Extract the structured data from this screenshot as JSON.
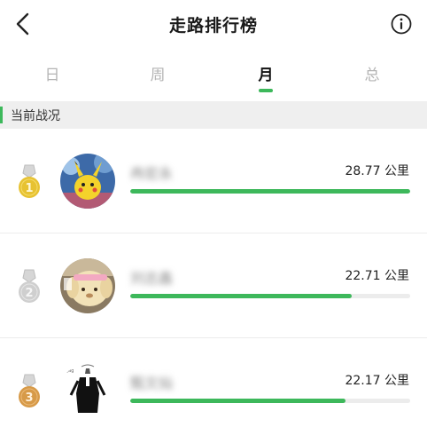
{
  "header": {
    "title": "走路排行榜",
    "back_icon": "chevron-left-icon",
    "info_icon": "info-circle-icon"
  },
  "tabs": [
    {
      "label": "日",
      "active": false
    },
    {
      "label": "周",
      "active": false
    },
    {
      "label": "月",
      "active": true
    },
    {
      "label": "总",
      "active": false
    }
  ],
  "section": {
    "title": "当前战况"
  },
  "colors": {
    "accent": "#3db85b",
    "gold": "#e7c232",
    "silver": "#cfcfcf",
    "bronze": "#d79a48"
  },
  "rankings": [
    {
      "rank": "1",
      "name": "冉宏永",
      "distance": "28.77 公里",
      "progress": 1.0,
      "medal": "gold-medal-icon",
      "avatar": "pikachu-avatar"
    },
    {
      "rank": "2",
      "name": "刘志鑫",
      "distance": "22.71 公里",
      "progress": 0.79,
      "medal": "silver-medal-icon",
      "avatar": "plush-toy-avatar"
    },
    {
      "rank": "3",
      "name": "甄文灿",
      "distance": "22.17 公里",
      "progress": 0.77,
      "medal": "bronze-medal-icon",
      "avatar": "figure-sketch-avatar"
    }
  ]
}
